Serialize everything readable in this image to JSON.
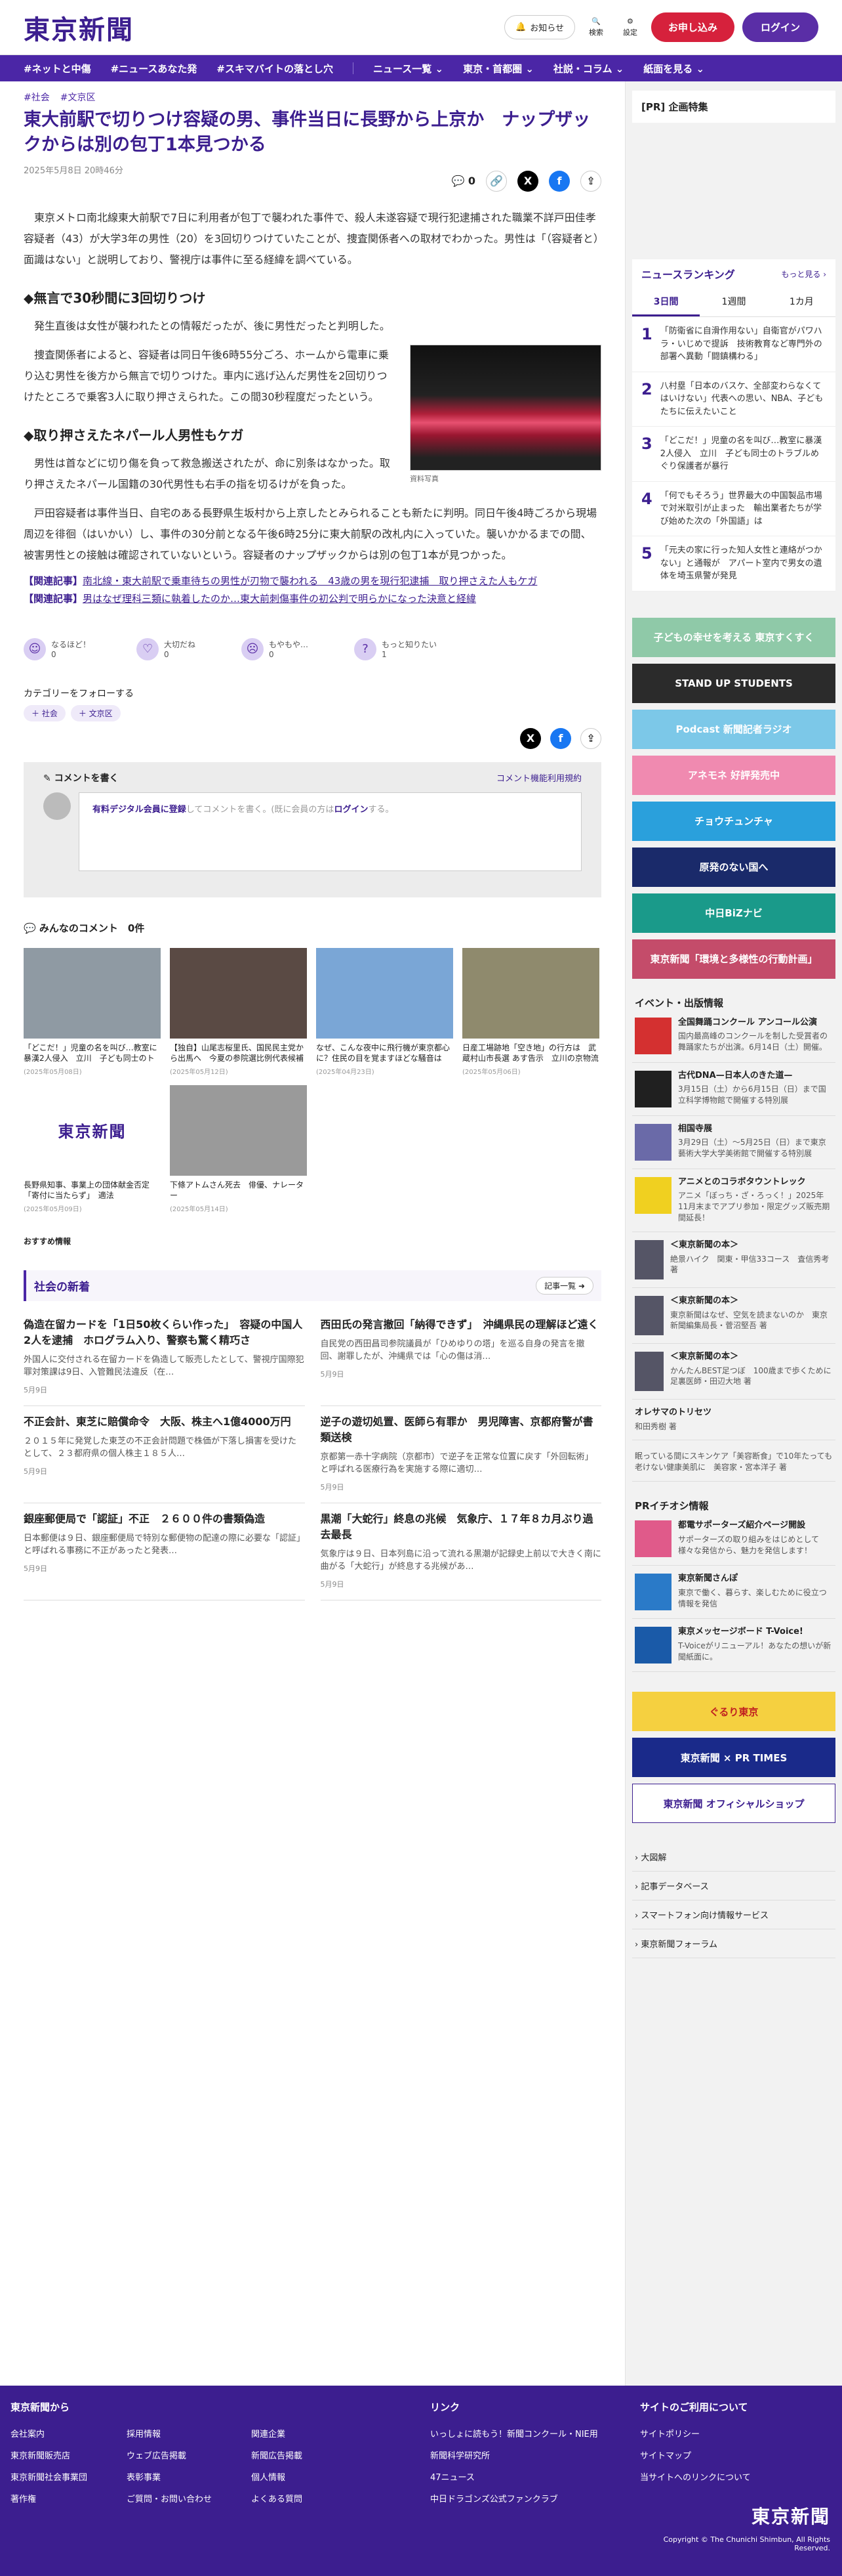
{
  "header": {
    "logo": "東京新聞",
    "notice": "お知らせ",
    "search": "検索",
    "settings": "設定",
    "apply": "お申し込み",
    "login": "ログイン"
  },
  "nav": [
    "#ネットと中傷",
    "#ニュースあなた発",
    "#スキマバイトの落とし穴",
    "ニュース一覧",
    "東京・首都圏",
    "社説・コラム",
    "紙面を見る"
  ],
  "article": {
    "tags": [
      "#社会",
      "#文京区"
    ],
    "title": "東大前駅で切りつけ容疑の男、事件当日に長野から上京か　ナップザックからは別の包丁1本見つかる",
    "date": "2025年5月8日 20時46分",
    "comment_count": "0",
    "lead": "東京メトロ南北線東大前駅で7日に利用者が包丁で襲われた事件で、殺人未遂容疑で現行犯逮捕された職業不詳戸田佳孝容疑者（43）が大学3年の男性（20）を3回切りつけていたことが、捜査関係者への取材でわかった。男性は「（容疑者と）面識はない」と説明しており、警視庁は事件に至る経緯を調べている。",
    "h2a": "◆無言で30秒間に3回切りつけ",
    "p1": "発生直後は女性が襲われたとの情報だったが、後に男性だったと判明した。",
    "p2": "捜査関係者によると、容疑者は同日午後6時55分ごろ、ホームから電車に乗り込む男性を後方から無言で切りつけた。車内に逃げ込んだ男性を2回切りつけたところで乗客3人に取り押さえられた。この間30秒程度だったという。",
    "h2b": "◆取り押さえたネパール人男性もケガ",
    "p3": "男性は首などに切り傷を負って救急搬送されたが、命に別条はなかった。取り押さえたネパール国籍の30代男性も右手の指を切るけがを負った。",
    "p4": "戸田容疑者は事件当日、自宅のある長野県生坂村から上京したとみられることも新たに判明。同日午後4時ごろから現場周辺を徘徊（はいかい）し、事件の30分前となる午後6時25分に東大前駅の改札内に入っていた。襲いかかるまでの間、被害男性との接触は確認されていないという。容疑者のナップザックからは別の包丁1本が見つかった。",
    "photo_caption": "資料写真",
    "related_label": "【関連記事】",
    "related": [
      "南北線・東大前駅で乗車待ちの男性が刃物で襲われる　43歳の男を現行犯逮捕　取り押さえた人もケガ",
      "男はなぜ理科三類に執着したのか…東大前刺傷事件の初公判で明らかになった決意と経緯"
    ]
  },
  "reactions": [
    {
      "label": "なるほど！",
      "count": "0"
    },
    {
      "label": "大切だね",
      "count": "0"
    },
    {
      "label": "もやもや…",
      "count": "0"
    },
    {
      "label": "もっと知りたい",
      "count": "1"
    }
  ],
  "follow": {
    "label": "カテゴリーをフォローする",
    "chips": [
      "＋ 社会",
      "＋ 文京区"
    ]
  },
  "comment_box": {
    "title": "コメントを書く",
    "terms": "コメント機能利用規約",
    "placeholder_link": "有料デジタル会員に登録",
    "placeholder_mid": "してコメントを書く。(既に会員の方は",
    "placeholder_login": "ログイン",
    "placeholder_end": "する。"
  },
  "all_comments": "みんなのコメント　0件",
  "cards": [
    {
      "title": "「どこだ！」児童の名を叫び…教室に暴漢2人侵入　立川　子ども同士のトラブルめぐり保護…",
      "date": "(2025年05月08日)",
      "color": "#8f9aa3"
    },
    {
      "title": "【独自】山尾志桜里氏、国民民主党から出馬へ　今夏の参院選比例代表候補に　「政策的な違…",
      "date": "(2025年05月12日)",
      "color": "#5a4a44"
    },
    {
      "title": "なぜ、こんな夜中に飛行機が東京都心に？住民の目を覚ますほどな騒音は「やむを得ず…」(二…",
      "date": "(2025年04月23日)",
      "color": "#7aa6d6"
    },
    {
      "title": "日産工場跡地「空き地」の行方は　武蔵村山市長選 あす告示　立川の京物流大人が所有　市の…",
      "date": "(2025年05月06日)",
      "color": "#8f8a6d"
    },
    {
      "title": "長野県知事、事業上の団体献金否定「寄付に当たらず」　適法",
      "date": "(2025年05月09日)",
      "color": "#ffffff"
    },
    {
      "title": "下條アトムさん死去　俳優、ナレーター",
      "date": "(2025年05月14日)",
      "color": "#9a9a9a"
    }
  ],
  "recommend": "おすすめ情報",
  "newsbox": {
    "title": "社会の新着",
    "more": "記事一覧"
  },
  "news": [
    {
      "h": "偽造在留カードを「1日50枚くらい作った」　容疑の中国人2人を逮捕　ホログラム入り、警察も驚く精巧さ",
      "b": "外国人に交付される在留カードを偽造して販売したとして、警視庁国際犯罪対策課は9日、入管難民法違反（在…",
      "d": "5月9日"
    },
    {
      "h": "西田氏の発言撤回「納得できず」　沖縄県民の理解ほど遠く",
      "b": "自民党の西田昌司参院議員が「ひめゆりの塔」を巡る自身の発言を撤回、謝罪したが、沖縄県では「心の傷は消…",
      "d": "5月9日"
    },
    {
      "h": "不正会計、東芝に賠償命令　大阪、株主へ1億4000万円",
      "b": "２０１５年に発覚した東芝の不正会計問題で株価が下落し損害を受けたとして、２３都府県の個人株主１８５人…",
      "d": "5月9日"
    },
    {
      "h": "逆子の遊切処置、医師ら有罪か　男児障害、京都府警が書類送検",
      "b": "京都第一赤十字病院（京都市）で逆子を正常な位置に戻す「外回転術」と呼ばれる医療行為を実施する際に適切…",
      "d": "5月9日"
    },
    {
      "h": "銀座郵便局で「認証」不正　２６００件の書類偽造",
      "b": "日本郵便は９日、銀座郵便局で特別な郵便物の配達の際に必要な「認証」と呼ばれる事務に不正があったと発表…",
      "d": "5月9日"
    },
    {
      "h": "黒潮「大蛇行」終息の兆候　気象庁、１７年８カ月ぶり過去最長",
      "b": "気象庁は９日、日本列島に沿って流れる黒潮が記録史上前以で大きく南に曲がる「大蛇行」が終息する兆候があ…",
      "d": "5月9日"
    }
  ],
  "sidebar": {
    "pr": "[PR] 企画特集",
    "ranking_title": "ニュースランキング",
    "ranking_more": "もっと見る",
    "tabs": [
      "3日間",
      "1週間",
      "1カ月"
    ],
    "ranking": [
      "「防衛省に自滑作用ない」自衛官がパワハラ・いじめで提訴　技術教育など専門外の部署へ異動「闘鎮構わる」",
      "八村塁「日本のバスケ、全部変わらなくてはいけない」代表への思い、NBA、子どもたちに伝えたいこと",
      "「どこだ！」児童の名を叫び…教室に暴漢2人侵入　立川　子ども同士のトラブルめぐり保護者が暴行",
      "「何でもそろう」世界最大の中国製品市場で対米取引が止まった　輸出業者たちが学び始めた次の「外国語」は",
      "「元夫の家に行った知人女性と連絡がつかない」と通報が　アパート室内で男女の遺体を埼玉県警が発見"
    ],
    "banners": [
      {
        "t": "子どもの幸せを考える 東京すくすく",
        "c": "#8fc9a8"
      },
      {
        "t": "STAND UP STUDENTS",
        "c": "#2b2b2b"
      },
      {
        "t": "Podcast 新聞記者ラジオ",
        "c": "#7cc8e8"
      },
      {
        "t": "アネモネ 好評発売中",
        "c": "#f08ab0"
      },
      {
        "t": "チョウチュンチャ",
        "c": "#2aa0dc"
      },
      {
        "t": "原発のない国へ",
        "c": "#1a2a6a"
      },
      {
        "t": "中日BiZナビ",
        "c": "#1a9a8a"
      },
      {
        "t": "東京新聞「環境と多様性の行動計画」",
        "c": "#c44c6a"
      }
    ],
    "events_title": "イベント・出版情報",
    "events": [
      {
        "h": "全国舞踊コンクール アンコール公演",
        "s": "国内最高峰のコンクールを制した受賞者の舞踊家たちが出演。6月14日（土）開催。",
        "c": "#d43030"
      },
      {
        "h": "古代DNA—日本人のきた道—",
        "s": "3月15日（土）から6月15日（日）まで国立科学博物館で開催する特別展",
        "c": "#202020"
      },
      {
        "h": "相国寺展",
        "s": "3月29日（土）〜5月25日（日）まで東京藝術大学大学美術館で開催する特別展",
        "c": "#6a6aa8"
      },
      {
        "h": "アニメとのコラボタウントレック",
        "s": "アニメ「ぼっち・ざ・ろっく！」2025年11月末までアプリ参加・限定グッズ販売期間延長！",
        "c": "#f0d020"
      }
    ],
    "books": [
      {
        "h": "＜東京新聞の本＞",
        "s": "絶景ハイク　関東・甲信33コース　査信秀考 著"
      },
      {
        "h": "＜東京新聞の本＞",
        "s": "東京新聞はなぜ、空気を読まないのか　東京新聞編集局長・菅沼堅吾 著"
      },
      {
        "h": "＜東京新聞の本＞",
        "s": "かんたんBEST足つぼ　100歳まで歩くために　足裏医師・田辺大地 著"
      }
    ],
    "extra": [
      {
        "h": "オレサマのトリセツ",
        "s": "和田秀樹 著"
      },
      {
        "h": "",
        "s": "眠っている間にスキンケア「美容断食」で10年たっても老けない健康美肌に　美容家・宮本洋子 著"
      }
    ],
    "pr_title": "PRイチオシ情報",
    "pr_items": [
      {
        "h": "都電サポーターズ紹介ページ開設",
        "s": "サポーターズの取り組みをはじめとして様々な発信から、魅力を発信します！"
      },
      {
        "h": "東京新聞さんぽ",
        "s": "東京で働く、暮らす、楽しむために役立つ情報を発信"
      },
      {
        "h": "東京メッセージボード T-Voice!",
        "s": "T-Voiceがリニューアル！あなたの想いが新聞紙面に。"
      }
    ],
    "bottom_banners": [
      {
        "t": "ぐるり東京",
        "c": "#f5d040",
        "tc": "#c02020"
      },
      {
        "t": "東京新聞 × PR TIMES",
        "c": "#1a2a8a",
        "tc": "#ffffff"
      },
      {
        "t": "東京新聞 オフィシャルショップ",
        "c": "#ffffff",
        "tc": "#3c1e8f"
      }
    ],
    "links": [
      "大図解",
      "記事データベース",
      "スマートフォン向け情報サービス",
      "東京新聞フォーラム"
    ]
  },
  "footer": {
    "col1_title": "東京新聞から",
    "col1": [
      [
        "会社案内",
        "東京新聞販売店",
        "東京新聞社会事業団",
        "著作権"
      ],
      [
        "採用情報",
        "ウェブ広告掲載",
        "表彰事業",
        "ご質問・お問い合わせ"
      ],
      [
        "関連企業",
        "新聞広告掲載",
        "個人情報",
        "よくある質問"
      ]
    ],
    "col2_title": "リンク",
    "col2": [
      "いっしょに読もう！新聞コンクール・NIE用",
      "新聞科学研究所",
      "47ニュース",
      "中日ドラゴンズ公式ファンクラブ"
    ],
    "col3_title": "サイトのご利用について",
    "col3": [
      "サイトポリシー",
      "サイトマップ",
      "当サイトへのリンクについて"
    ],
    "logo": "東京新聞",
    "copyright": "Copyright © The Chunichi Shimbun, All Rights Reserved."
  }
}
